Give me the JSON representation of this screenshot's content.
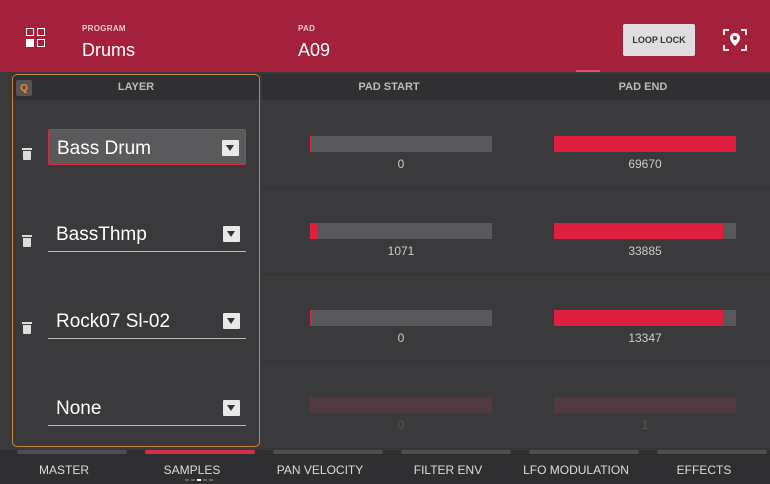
{
  "header": {
    "program_label": "PROGRAM",
    "program_value": "Drums",
    "pad_label": "PAD",
    "pad_value": "A09",
    "loop_lock_label": "LOOP LOCK"
  },
  "columns": {
    "q_badge": "Q",
    "layer": "LAYER",
    "pad_start": "PAD START",
    "pad_end": "PAD END"
  },
  "layers": [
    {
      "name": "Bass Drum",
      "pad_start": "0",
      "pad_end": "69670",
      "start_fill": 0.01,
      "end_fill": 1.0,
      "active": true,
      "enabled": true
    },
    {
      "name": "BassThmp",
      "pad_start": "1071",
      "pad_end": "33885",
      "start_fill": 0.04,
      "end_fill": 0.93,
      "active": false,
      "enabled": true
    },
    {
      "name": "Rock07 Sl-02",
      "pad_start": "0",
      "pad_end": "13347",
      "start_fill": 0.01,
      "end_fill": 0.93,
      "active": false,
      "enabled": true
    },
    {
      "name": "None",
      "pad_start": "0",
      "pad_end": "1",
      "start_fill": 0,
      "end_fill": 0,
      "active": false,
      "enabled": false
    }
  ],
  "tabs": [
    {
      "label": "MASTER",
      "active": false
    },
    {
      "label": "SAMPLES",
      "active": true
    },
    {
      "label": "PAN VELOCITY",
      "active": false
    },
    {
      "label": "FILTER ENV",
      "active": false
    },
    {
      "label": "LFO MODULATION",
      "active": false
    },
    {
      "label": "EFFECTS",
      "active": false
    }
  ],
  "colors": {
    "accent": "#a3213a",
    "bar_fill": "#dd1f40",
    "layer_frame": "#c9853a"
  }
}
